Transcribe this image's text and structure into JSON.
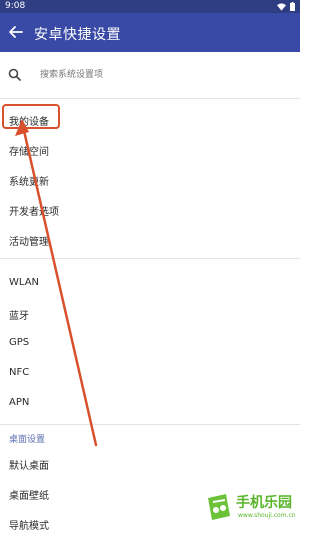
{
  "status_bar": {
    "time": "9:08"
  },
  "app_bar": {
    "title": "安卓快捷设置"
  },
  "search": {
    "placeholder": "搜索系统设置项"
  },
  "group1": [
    {
      "label": "我的设备"
    },
    {
      "label": "存储空间"
    },
    {
      "label": "系统更新"
    },
    {
      "label": "开发者选项"
    },
    {
      "label": "活动管理"
    }
  ],
  "group2": [
    {
      "label": "WLAN"
    },
    {
      "label": "蓝牙"
    },
    {
      "label": "GPS"
    },
    {
      "label": "NFC"
    },
    {
      "label": "APN"
    }
  ],
  "section_desktop": {
    "header": "桌面设置",
    "items": [
      {
        "label": "默认桌面"
      },
      {
        "label": "桌面壁纸"
      },
      {
        "label": "导航模式"
      }
    ]
  },
  "watermark": {
    "text": "手机乐园",
    "url": "www.shouji.com.cn"
  },
  "colors": {
    "app_bar": "#3949a6",
    "status_bar": "#2f3e83",
    "annotation": "#d9502c",
    "section_header": "#5a6fb0",
    "watermark": "#5ab52a"
  }
}
